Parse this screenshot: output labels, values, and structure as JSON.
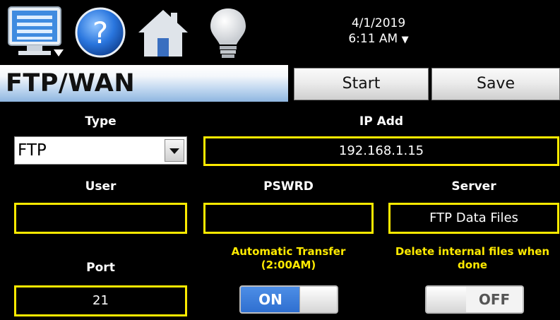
{
  "toolbar": {
    "icons": [
      "monitor-menu-icon",
      "help-icon",
      "home-icon",
      "lightbulb-icon"
    ],
    "date": "4/1/2019",
    "time": "6:11 AM",
    "time_arrow": "▼"
  },
  "header": {
    "title": "FTP/WAN",
    "start_label": "Start",
    "save_label": "Save"
  },
  "form": {
    "type": {
      "label": "Type",
      "value": "FTP"
    },
    "ip": {
      "label": "IP Add",
      "value": "192.168.1.15"
    },
    "user": {
      "label": "User",
      "value": ""
    },
    "password": {
      "label": "PSWRD",
      "value": ""
    },
    "server": {
      "label": "Server",
      "value": "FTP Data Files"
    },
    "port": {
      "label": "Port",
      "value": "21"
    },
    "auto_transfer": {
      "label_line1": "Automatic Transfer",
      "label_line2": "(2:00AM)",
      "state": "ON"
    },
    "delete_files": {
      "label_line1": "Delete internal files when",
      "label_line2": "done",
      "state": "OFF"
    }
  },
  "colors": {
    "field_border": "#ffea00",
    "toggle_on": "#2f6fd0",
    "title_gradient_bottom": "#8fb6e0"
  }
}
